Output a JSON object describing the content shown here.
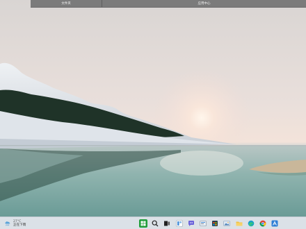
{
  "topbar": {
    "files_label": "文件夹",
    "app_center_label": "应用中心"
  },
  "weather": {
    "temperature": "27°C",
    "condition": "正在下雨",
    "icon": "rain-cloud-icon"
  },
  "taskbar": {
    "icons": [
      "start-icon",
      "search-icon",
      "task-view-icon",
      "widgets-icon",
      "chat-icon",
      "settings-icon",
      "store-icon",
      "photos-icon",
      "file-explorer-icon",
      "edge-icon",
      "chrome-icon",
      "app-icon"
    ]
  },
  "colors": {
    "taskbar_bg": "#e0e4ea",
    "topbar_bg": "#7b7b7b",
    "start_green": "#3fbf3f"
  }
}
